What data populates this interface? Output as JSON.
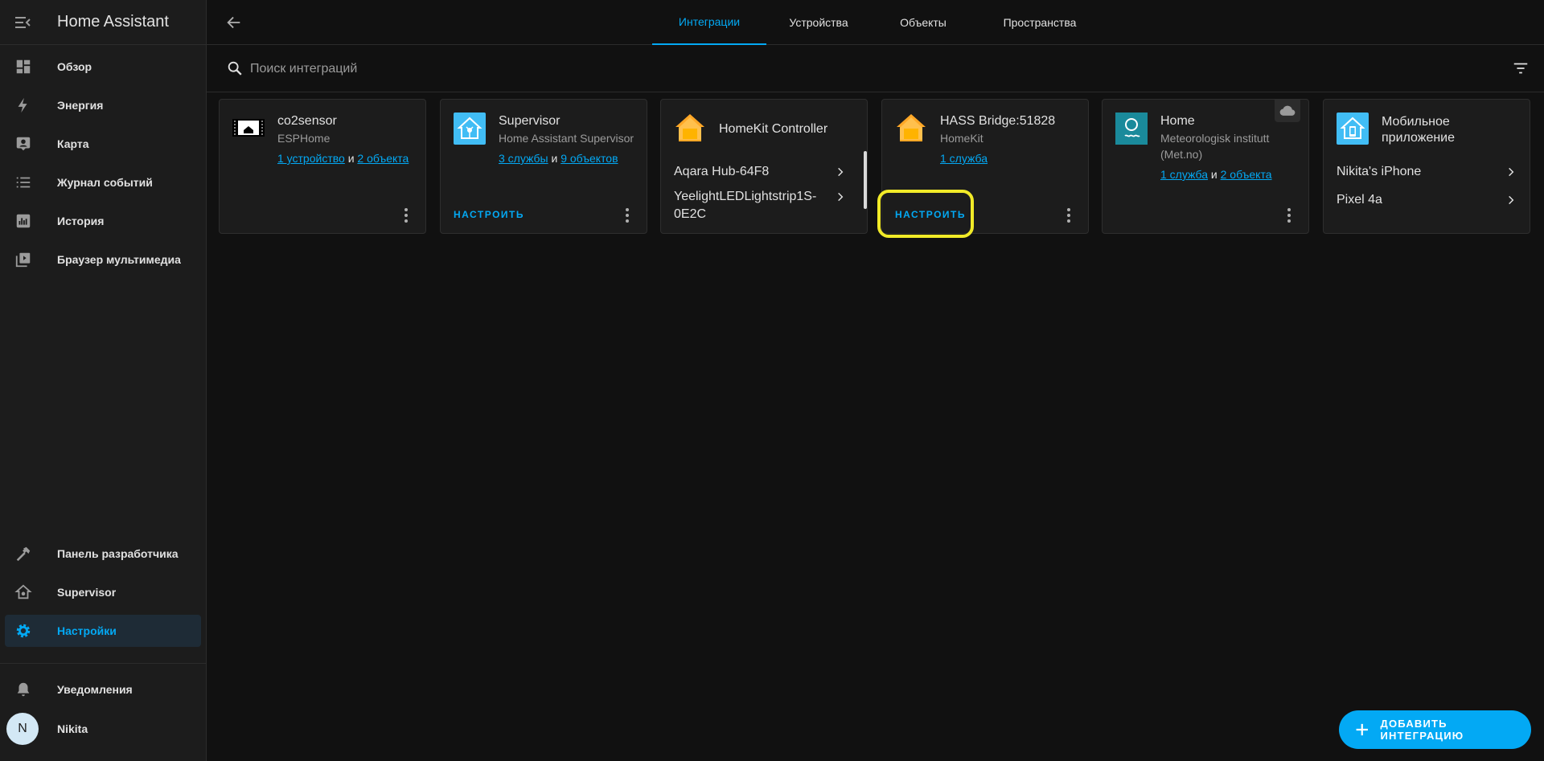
{
  "sidebar": {
    "title": "Home Assistant",
    "items": [
      {
        "label": "Обзор",
        "icon": "dashboard-icon"
      },
      {
        "label": "Энергия",
        "icon": "lightning-icon"
      },
      {
        "label": "Карта",
        "icon": "map-icon"
      },
      {
        "label": "Журнал событий",
        "icon": "logbook-icon"
      },
      {
        "label": "История",
        "icon": "history-icon"
      },
      {
        "label": "Браузер мультимедиа",
        "icon": "media-icon"
      }
    ],
    "bottom_items": [
      {
        "label": "Панель разработчика",
        "icon": "hammer-icon"
      },
      {
        "label": "Supervisor",
        "icon": "supervisor-icon"
      },
      {
        "label": "Настройки",
        "icon": "gear-icon",
        "active": true
      }
    ],
    "notifications_label": "Уведомления",
    "user": {
      "initial": "N",
      "name": "Nikita"
    }
  },
  "tabs": [
    "Интеграции",
    "Устройства",
    "Объекты",
    "Пространства"
  ],
  "active_tab": "Интеграции",
  "search": {
    "placeholder": "Поиск интеграций"
  },
  "cards": [
    {
      "title": "co2sensor",
      "subtitle": "ESPHome",
      "link1": "1 устройство",
      "joiner": "и",
      "link2": "2 объекта"
    },
    {
      "title": "Supervisor",
      "subtitle": "Home Assistant Supervisor",
      "link1": "3 службы",
      "joiner": "и",
      "link2": "9 объектов",
      "action": "НАСТРОИТЬ"
    },
    {
      "title": "HomeKit Controller",
      "entries": [
        "Aqara Hub-64F8",
        "YeelightLEDLightstrip1S-",
        "0E2C"
      ]
    },
    {
      "title": "HASS Bridge:51828",
      "subtitle": "HomeKit",
      "link1": "1 служба",
      "action": "НАСТРОИТЬ"
    },
    {
      "title": "Home",
      "subtitle1": "Meteorologisk institutt",
      "subtitle2": "(Met.no)",
      "link1": "1 служба",
      "joiner": "и",
      "link2": "2 объекта"
    },
    {
      "title1": "Мобильное",
      "title2": "приложение",
      "entries": [
        "Nikita's iPhone",
        "Pixel 4a"
      ]
    }
  ],
  "fab": {
    "label": "ДОБАВИТЬ ИНТЕГРАЦИЮ"
  },
  "colors": {
    "accent": "#03a9f4",
    "highlight": "#f1ea28",
    "homekit": "#ff9800"
  }
}
